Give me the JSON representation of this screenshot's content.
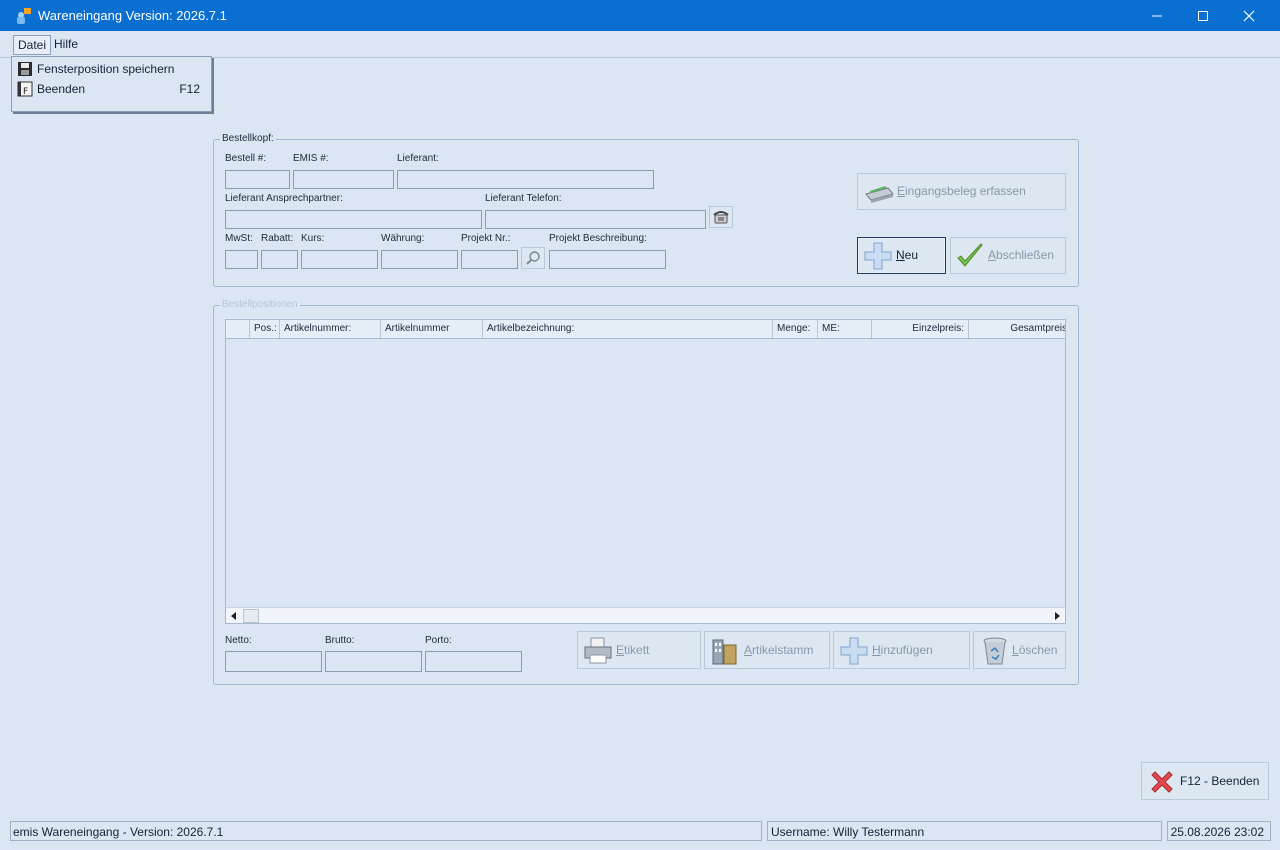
{
  "window": {
    "title": "Wareneingang Version: 2026.7.1",
    "accent": "#0a6fd0"
  },
  "menu": {
    "file_label": "Datei",
    "help_label": "Hilfe",
    "file_items": [
      {
        "label": "Fensterposition speichern",
        "shortcut": "",
        "icon": "floppy-disk-icon"
      },
      {
        "label": "Beenden",
        "shortcut": "F12",
        "icon": "exit-app-icon"
      }
    ]
  },
  "header_group": {
    "legend": "Bestellkopf:",
    "labels": {
      "bestell_nr": "Bestell #:",
      "emis_nr": "EMIS #:",
      "lieferant": "Lieferant:",
      "ansprechpartner": "Lieferant Ansprechpartner:",
      "telefon": "Lieferant Telefon:",
      "mwst": "MwSt:",
      "rabatt": "Rabatt:",
      "kurs": "Kurs:",
      "waehrung": "Währung:",
      "projekt_nr": "Projekt Nr.:",
      "projekt_beschreibung": "Projekt Beschreibung:"
    },
    "values": {
      "bestell_nr": "",
      "emis_nr": "",
      "lieferant": "",
      "ansprechpartner": "",
      "telefon": "",
      "mwst": "",
      "rabatt": "",
      "kurs": "",
      "waehrung": "",
      "projekt_nr": "",
      "projekt_beschreibung": ""
    },
    "buttons": {
      "eingangsbeleg": "Eingangsbeleg erfassen",
      "neu": "Neu",
      "abschliessen": "Abschließen"
    }
  },
  "positions_group": {
    "legend": "Bestellpositionen",
    "columns": [
      "Pos.:",
      "Artikelnummer:",
      "Artikelnummer",
      "Artikelbezeichnung:",
      "Menge:",
      "ME:",
      "Einzelpreis:",
      "Gesamtpreis"
    ],
    "rows": []
  },
  "totals": {
    "netto_label": "Netto:",
    "brutto_label": "Brutto:",
    "porto_label": "Porto:",
    "netto": "",
    "brutto": "",
    "porto": ""
  },
  "position_buttons": {
    "etikett": "Etikett",
    "artikelstamm": "Artikelstamm",
    "hinzufuegen": "Hinzufügen",
    "loeschen": "Löschen"
  },
  "exit_button": {
    "label": "F12 - Beenden"
  },
  "statusbar": {
    "version": "emis Wareneingang - Version: 2026.7.1",
    "user": "Username: Willy Testermann",
    "datetime": "25.08.2026 23:02"
  }
}
